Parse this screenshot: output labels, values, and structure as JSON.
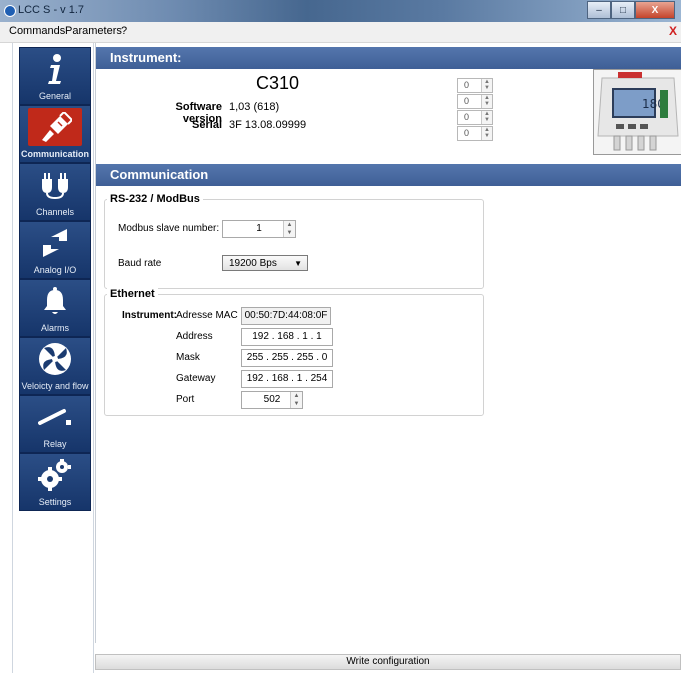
{
  "window": {
    "title": "LCC S - v 1.7",
    "min": "–",
    "max": "□",
    "close": "X"
  },
  "menu": {
    "items": [
      "Commands",
      "Parameters",
      "?"
    ],
    "close_mark": "X"
  },
  "sidebar": {
    "items": [
      {
        "label": "General",
        "icon": "info-icon"
      },
      {
        "label": "Communication",
        "icon": "ethernet-plug-icon",
        "active": true
      },
      {
        "label": "Channels",
        "icon": "plug-icon"
      },
      {
        "label": "Analog I/O",
        "icon": "arrows-icon"
      },
      {
        "label": "Alarms",
        "icon": "bell-icon"
      },
      {
        "label": "Veloicty and flow",
        "icon": "fan-icon"
      },
      {
        "label": "Relay",
        "icon": "relay-switch-icon"
      },
      {
        "label": "Settings",
        "icon": "gears-icon"
      }
    ]
  },
  "instrument": {
    "header": "Instrument:",
    "name": "C310",
    "software_label": "Software version",
    "software_value": "1,03 (618)",
    "serial_label": "Serial",
    "serial_value": "3F 13.08.09999",
    "spinners": [
      "0",
      "0",
      "0",
      "0"
    ],
    "device_display": "180"
  },
  "communication": {
    "header": "Communication",
    "rs232": {
      "title": "RS-232 / ModBus",
      "slave_label": "Modbus slave number:",
      "slave_value": "1",
      "baud_label": "Baud rate",
      "baud_value": "19200 Bps"
    },
    "ethernet": {
      "title": "Ethernet",
      "instrument_label": "Instrument:",
      "mac_label": "Adresse MAC",
      "mac_value": "00:50:7D:44:08:0F",
      "address_label": "Address",
      "address_value": "192 . 168 .  1  .  1",
      "mask_label": "Mask",
      "mask_value": "255 . 255 . 255 .  0",
      "gateway_label": "Gateway",
      "gateway_value": "192 . 168 .  1  . 254",
      "port_label": "Port",
      "port_value": "502"
    }
  },
  "footer": {
    "write_label": "Write configuration"
  },
  "colors": {
    "accent": "#3f5f96",
    "nav": "#1b3b70",
    "active": "#c0291a"
  }
}
